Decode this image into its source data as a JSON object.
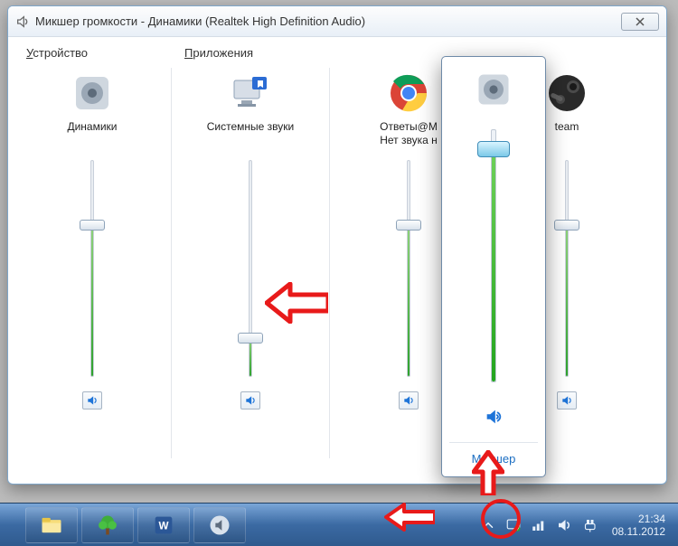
{
  "window": {
    "title": "Микшер громкости - Динамики (Realtek High Definition Audio)",
    "section_device_label": "Устройство",
    "section_device_underline": "У",
    "section_apps_label": "Приложения",
    "section_apps_underline": "П"
  },
  "columns": [
    {
      "icon": "speaker-device-icon",
      "label": "Динамики",
      "level": 70,
      "muted": false
    },
    {
      "icon": "system-sounds-icon",
      "label": "Системные звуки",
      "level": 18,
      "muted": false
    },
    {
      "icon": "chrome-icon",
      "label": "Ответы@M\nНет звука н",
      "level": 70,
      "muted": false
    },
    {
      "icon": "steam-icon",
      "label": "team",
      "level": 70,
      "muted": false
    }
  ],
  "flyout": {
    "device_icon": "speaker-device-icon",
    "level": 92,
    "muted": false,
    "mixer_link": "Микшер"
  },
  "taskbar": {
    "apps": [
      {
        "name": "explorer-icon"
      },
      {
        "name": "tree-app-icon"
      },
      {
        "name": "word-icon"
      },
      {
        "name": "volume-tray-task-icon"
      }
    ],
    "tray": [
      {
        "name": "chevron-up-icon"
      },
      {
        "name": "action-center-icon"
      },
      {
        "name": "network-icon"
      },
      {
        "name": "volume-tray-icon"
      },
      {
        "name": "power-icon"
      }
    ],
    "time": "21:34",
    "date": "08.11.2012"
  }
}
